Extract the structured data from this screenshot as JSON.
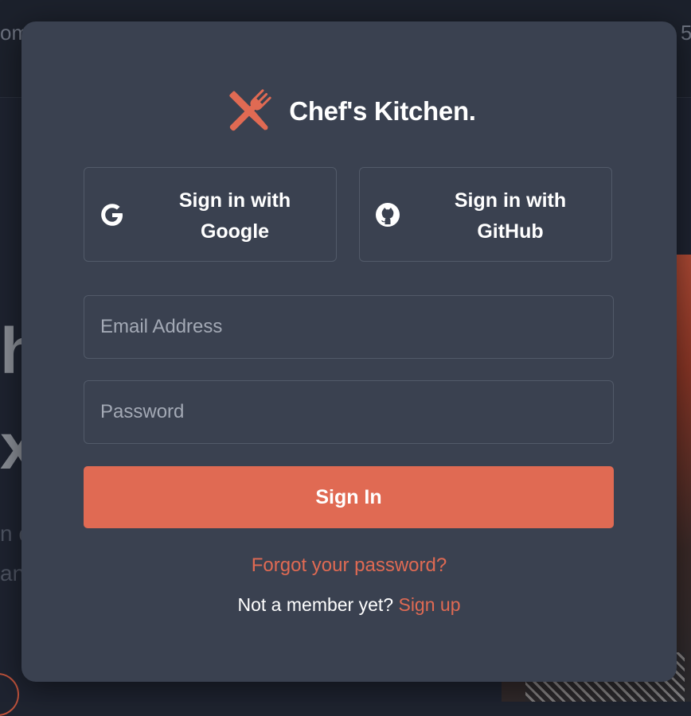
{
  "background": {
    "top_left_fragment": "om",
    "top_right_fragment": "5",
    "hero_line1_fragment": "h",
    "hero_line2_fragment": "x",
    "para_line1_fragment": "n c",
    "para_line2_fragment": "an"
  },
  "modal": {
    "brand": {
      "name": "Chef's Kitchen.",
      "logo_icon": "knife-fork-cross-icon",
      "accent_color": "#e06a53"
    },
    "oauth": {
      "google": {
        "label": "Sign in with Google",
        "icon": "google-icon"
      },
      "github": {
        "label": "Sign in with GitHub",
        "icon": "github-icon"
      }
    },
    "form": {
      "email_placeholder": "Email Address",
      "email_value": "",
      "password_placeholder": "Password",
      "password_value": "",
      "submit_label": "Sign In"
    },
    "links": {
      "forgot": "Forgot your password?",
      "member_prompt": "Not a member yet?",
      "signup": "Sign up"
    }
  },
  "colors": {
    "modal_bg": "#3a4150",
    "page_bg": "#1e2330",
    "accent": "#e06a53",
    "border": "#525a69"
  }
}
